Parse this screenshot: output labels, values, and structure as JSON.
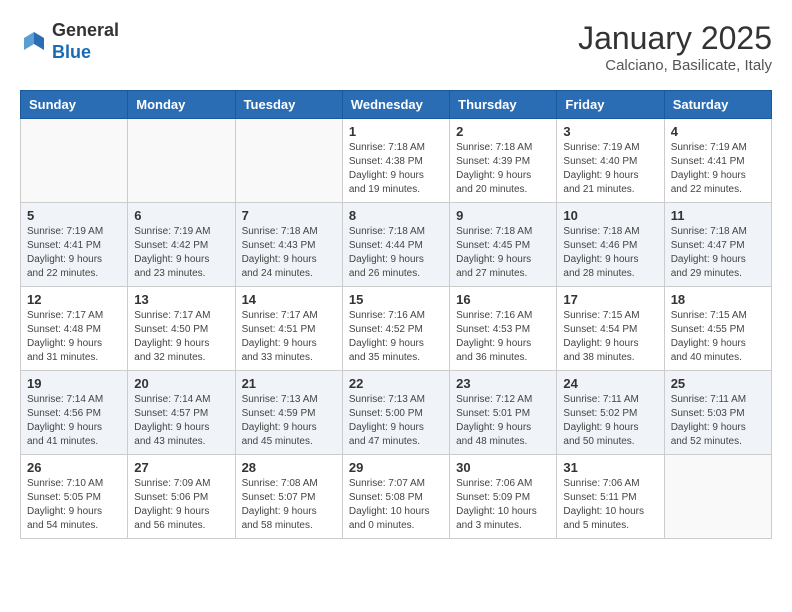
{
  "header": {
    "logo_general": "General",
    "logo_blue": "Blue",
    "month_title": "January 2025",
    "subtitle": "Calciano, Basilicate, Italy"
  },
  "days_of_week": [
    "Sunday",
    "Monday",
    "Tuesday",
    "Wednesday",
    "Thursday",
    "Friday",
    "Saturday"
  ],
  "weeks": [
    [
      {
        "day": "",
        "info": ""
      },
      {
        "day": "",
        "info": ""
      },
      {
        "day": "",
        "info": ""
      },
      {
        "day": "1",
        "info": "Sunrise: 7:18 AM\nSunset: 4:38 PM\nDaylight: 9 hours\nand 19 minutes."
      },
      {
        "day": "2",
        "info": "Sunrise: 7:18 AM\nSunset: 4:39 PM\nDaylight: 9 hours\nand 20 minutes."
      },
      {
        "day": "3",
        "info": "Sunrise: 7:19 AM\nSunset: 4:40 PM\nDaylight: 9 hours\nand 21 minutes."
      },
      {
        "day": "4",
        "info": "Sunrise: 7:19 AM\nSunset: 4:41 PM\nDaylight: 9 hours\nand 22 minutes."
      }
    ],
    [
      {
        "day": "5",
        "info": "Sunrise: 7:19 AM\nSunset: 4:41 PM\nDaylight: 9 hours\nand 22 minutes."
      },
      {
        "day": "6",
        "info": "Sunrise: 7:19 AM\nSunset: 4:42 PM\nDaylight: 9 hours\nand 23 minutes."
      },
      {
        "day": "7",
        "info": "Sunrise: 7:18 AM\nSunset: 4:43 PM\nDaylight: 9 hours\nand 24 minutes."
      },
      {
        "day": "8",
        "info": "Sunrise: 7:18 AM\nSunset: 4:44 PM\nDaylight: 9 hours\nand 26 minutes."
      },
      {
        "day": "9",
        "info": "Sunrise: 7:18 AM\nSunset: 4:45 PM\nDaylight: 9 hours\nand 27 minutes."
      },
      {
        "day": "10",
        "info": "Sunrise: 7:18 AM\nSunset: 4:46 PM\nDaylight: 9 hours\nand 28 minutes."
      },
      {
        "day": "11",
        "info": "Sunrise: 7:18 AM\nSunset: 4:47 PM\nDaylight: 9 hours\nand 29 minutes."
      }
    ],
    [
      {
        "day": "12",
        "info": "Sunrise: 7:17 AM\nSunset: 4:48 PM\nDaylight: 9 hours\nand 31 minutes."
      },
      {
        "day": "13",
        "info": "Sunrise: 7:17 AM\nSunset: 4:50 PM\nDaylight: 9 hours\nand 32 minutes."
      },
      {
        "day": "14",
        "info": "Sunrise: 7:17 AM\nSunset: 4:51 PM\nDaylight: 9 hours\nand 33 minutes."
      },
      {
        "day": "15",
        "info": "Sunrise: 7:16 AM\nSunset: 4:52 PM\nDaylight: 9 hours\nand 35 minutes."
      },
      {
        "day": "16",
        "info": "Sunrise: 7:16 AM\nSunset: 4:53 PM\nDaylight: 9 hours\nand 36 minutes."
      },
      {
        "day": "17",
        "info": "Sunrise: 7:15 AM\nSunset: 4:54 PM\nDaylight: 9 hours\nand 38 minutes."
      },
      {
        "day": "18",
        "info": "Sunrise: 7:15 AM\nSunset: 4:55 PM\nDaylight: 9 hours\nand 40 minutes."
      }
    ],
    [
      {
        "day": "19",
        "info": "Sunrise: 7:14 AM\nSunset: 4:56 PM\nDaylight: 9 hours\nand 41 minutes."
      },
      {
        "day": "20",
        "info": "Sunrise: 7:14 AM\nSunset: 4:57 PM\nDaylight: 9 hours\nand 43 minutes."
      },
      {
        "day": "21",
        "info": "Sunrise: 7:13 AM\nSunset: 4:59 PM\nDaylight: 9 hours\nand 45 minutes."
      },
      {
        "day": "22",
        "info": "Sunrise: 7:13 AM\nSunset: 5:00 PM\nDaylight: 9 hours\nand 47 minutes."
      },
      {
        "day": "23",
        "info": "Sunrise: 7:12 AM\nSunset: 5:01 PM\nDaylight: 9 hours\nand 48 minutes."
      },
      {
        "day": "24",
        "info": "Sunrise: 7:11 AM\nSunset: 5:02 PM\nDaylight: 9 hours\nand 50 minutes."
      },
      {
        "day": "25",
        "info": "Sunrise: 7:11 AM\nSunset: 5:03 PM\nDaylight: 9 hours\nand 52 minutes."
      }
    ],
    [
      {
        "day": "26",
        "info": "Sunrise: 7:10 AM\nSunset: 5:05 PM\nDaylight: 9 hours\nand 54 minutes."
      },
      {
        "day": "27",
        "info": "Sunrise: 7:09 AM\nSunset: 5:06 PM\nDaylight: 9 hours\nand 56 minutes."
      },
      {
        "day": "28",
        "info": "Sunrise: 7:08 AM\nSunset: 5:07 PM\nDaylight: 9 hours\nand 58 minutes."
      },
      {
        "day": "29",
        "info": "Sunrise: 7:07 AM\nSunset: 5:08 PM\nDaylight: 10 hours\nand 0 minutes."
      },
      {
        "day": "30",
        "info": "Sunrise: 7:06 AM\nSunset: 5:09 PM\nDaylight: 10 hours\nand 3 minutes."
      },
      {
        "day": "31",
        "info": "Sunrise: 7:06 AM\nSunset: 5:11 PM\nDaylight: 10 hours\nand 5 minutes."
      },
      {
        "day": "",
        "info": ""
      }
    ]
  ]
}
